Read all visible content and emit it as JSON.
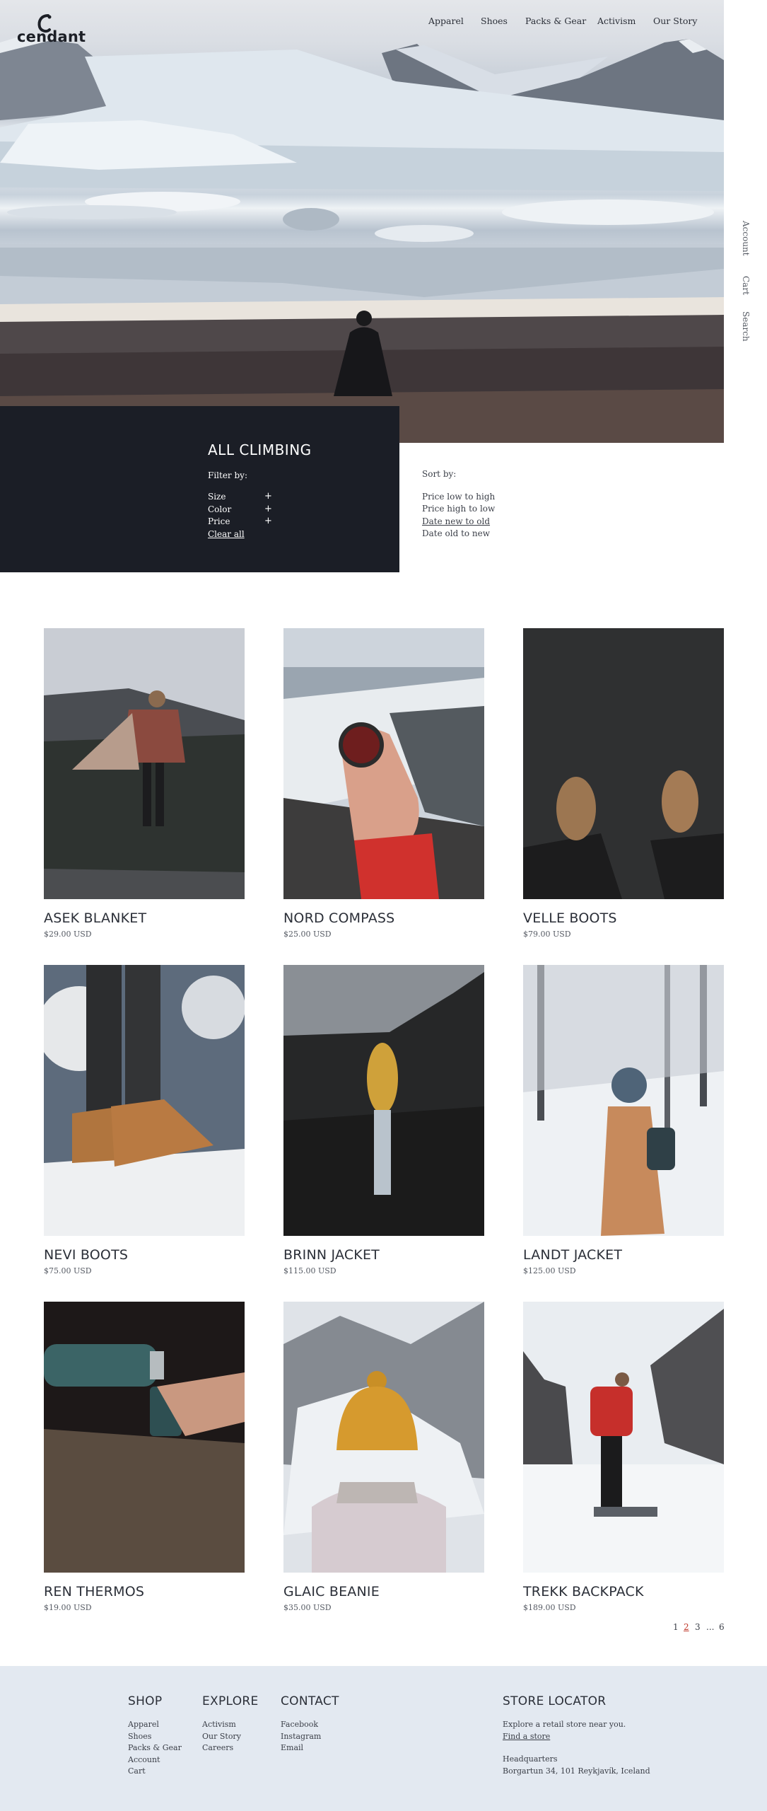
{
  "brand": {
    "name": "cendant"
  },
  "nav": {
    "top": [
      "Apparel",
      "Shoes",
      "Packs & Gear",
      "Activism",
      "Our Story"
    ],
    "side": [
      "Account",
      "Cart",
      "Search"
    ]
  },
  "filter": {
    "title": "ALL CLIMBING",
    "filter_by": "Filter by:",
    "options": [
      {
        "label": "Size",
        "icon": "+"
      },
      {
        "label": "Color",
        "icon": "+"
      },
      {
        "label": "Price",
        "icon": "+"
      }
    ],
    "clear_all": "Clear all"
  },
  "sort": {
    "label": "Sort by:",
    "options": [
      "Price low to high",
      "Price high to low",
      "Date new to old",
      "Date old to new"
    ],
    "selected": "Date new to old"
  },
  "products": [
    {
      "name": "ASEK BLANKET",
      "price": "$29.00 USD"
    },
    {
      "name": "NORD COMPASS",
      "price": "$25.00 USD"
    },
    {
      "name": "VELLE BOOTS",
      "price": "$79.00 USD"
    },
    {
      "name": "NEVI BOOTS",
      "price": "$75.00 USD"
    },
    {
      "name": "BRINN JACKET",
      "price": "$115.00 USD"
    },
    {
      "name": "LANDT JACKET",
      "price": "$125.00 USD"
    },
    {
      "name": "REN THERMOS",
      "price": "$19.00 USD"
    },
    {
      "name": "GLAIC BEANIE",
      "price": "$35.00 USD"
    },
    {
      "name": "TREKK BACKPACK",
      "price": "$189.00 USD"
    }
  ],
  "pagination": {
    "pages": [
      "1",
      "2",
      "3",
      "...",
      "6"
    ],
    "current": "2"
  },
  "footer": {
    "shop": {
      "title": "SHOP",
      "links": [
        "Apparel",
        "Shoes",
        "Packs & Gear",
        "Account",
        "Cart"
      ]
    },
    "explore": {
      "title": "EXPLORE",
      "links": [
        "Activism",
        "Our Story",
        "Careers"
      ]
    },
    "contact": {
      "title": "CONTACT",
      "links": [
        "Facebook",
        "Instagram",
        "Email"
      ]
    },
    "store_locator": {
      "title": "STORE LOCATOR",
      "text": "Explore a retail store near you.",
      "link": "Find a store",
      "hq_label": "Headquarters",
      "hq_address": "Borgartun 34, 101 Reykjavík, Iceland"
    }
  },
  "colors": {
    "panel": "#1b1e26",
    "footer": "#e3e9f1",
    "accent": "#c0392b"
  }
}
